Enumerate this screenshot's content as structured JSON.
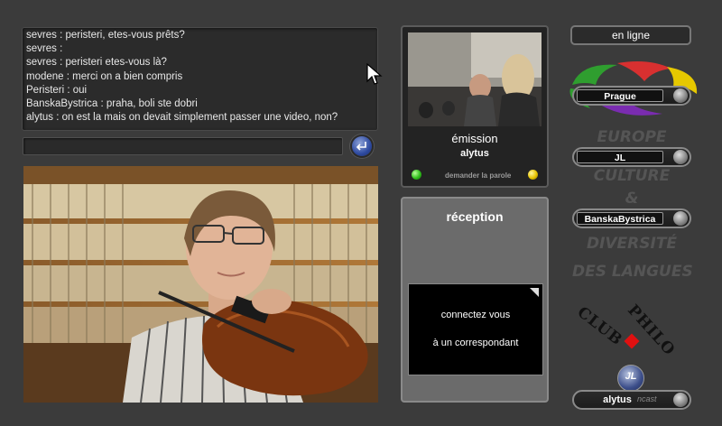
{
  "chat": {
    "lines": [
      "sevres : peristeri, etes-vous prêts?",
      "sevres :",
      "sevres : peristeri etes-vous là?",
      "modene : merci  on a bien compris",
      "Peristeri : oui",
      "BanskaBystrica : praha, boli ste dobri",
      "alytus : on est la mais on devait simplement passer une video, non?"
    ],
    "input_value": ""
  },
  "emission": {
    "title": "émission",
    "user": "alytus",
    "request_label": "demander la parole"
  },
  "reception": {
    "title": "réception",
    "message_line1": "connectez vous",
    "message_line2": "à un  correspondant"
  },
  "right": {
    "online_label": "en ligne",
    "participants": [
      "Prague",
      "JL",
      "BanskaBystrica",
      "alytus"
    ],
    "logo_lines": [
      "EUROPE",
      "CULTURE",
      "&",
      "DIVERSITÉ",
      "DES LANGUES"
    ],
    "club_text": "CLUB",
    "philo_text": "PHILO",
    "footer_brand": "JL",
    "footer_suffix": "ncast"
  },
  "colors": {
    "background": "#3b3b3b",
    "send_button": "#2e4aa0",
    "led_green": "#2fbf1b",
    "led_yellow": "#e7c400",
    "club_diamond": "#e01010"
  },
  "icons": {
    "send": "enter-arrow-icon",
    "cursor": "mouse-pointer-icon"
  }
}
